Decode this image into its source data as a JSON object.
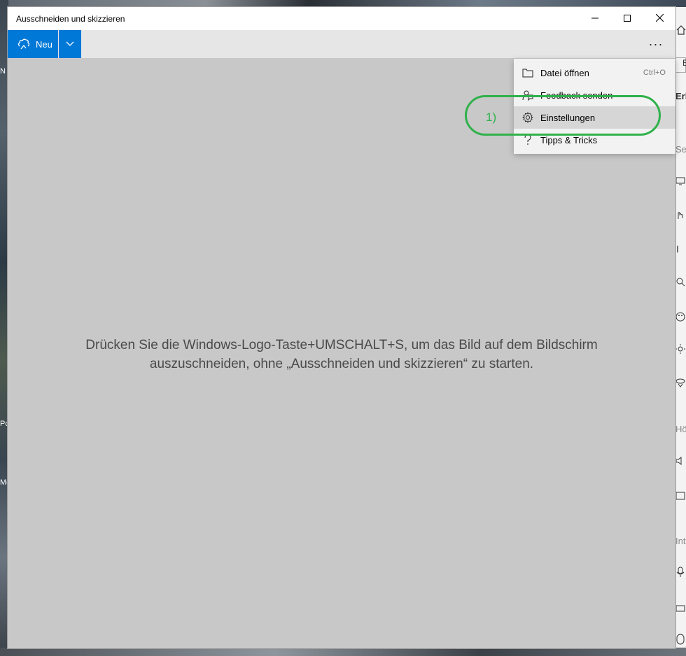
{
  "app": {
    "title": "Ausschneiden und skizzieren"
  },
  "toolbar": {
    "new_label": "Neu",
    "more_label": "···"
  },
  "main": {
    "hint_line1": "Drücken Sie die Windows-Logo-Taste+UMSCHALT+S, um das Bild auf dem Bildschirm",
    "hint_line2": "auszuschneiden, ohne „Ausschneiden und skizzieren“ zu starten."
  },
  "menu": {
    "items": [
      {
        "label": "Datei öffnen",
        "shortcut": "Ctrl+O",
        "icon": "folder-icon"
      },
      {
        "label": "Feedback senden",
        "shortcut": "",
        "icon": "feedback-icon"
      },
      {
        "label": "Einstellungen",
        "shortcut": "",
        "icon": "gear-icon",
        "active": true
      },
      {
        "label": "Tipps & Tricks",
        "shortcut": "",
        "icon": "question-icon"
      }
    ]
  },
  "annotation": {
    "label": "1)",
    "color": "#2fb14a"
  },
  "colors": {
    "accent": "#0078d7",
    "canvas": "#c8c8c8"
  },
  "background": {
    "desktop_labels": [
      "N",
      "Po",
      "Mc"
    ],
    "settings_items": [
      "E",
      "Erl",
      "Se",
      "Hö",
      "Int"
    ]
  }
}
